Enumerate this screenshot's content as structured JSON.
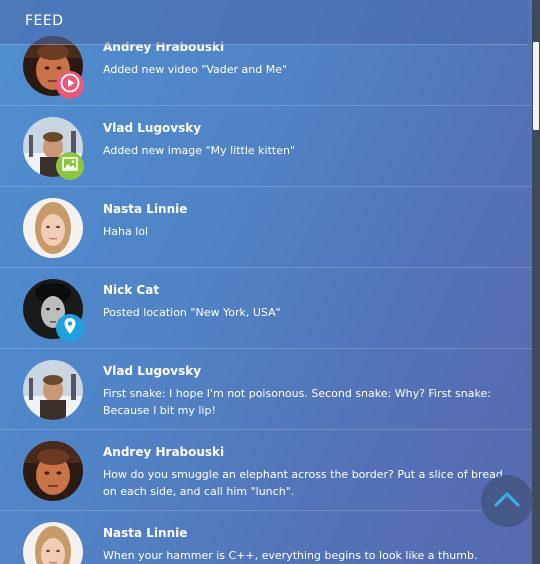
{
  "header": {
    "title": "FEED"
  },
  "feed": [
    {
      "name": "Andrey Hrabouski",
      "text": "Added new video \"Vader and Me\"",
      "avatar": "andrey",
      "badge": "video"
    },
    {
      "name": "Vlad Lugovsky",
      "text": "Added new image \"My little kitten\"",
      "avatar": "vlad",
      "badge": "image"
    },
    {
      "name": "Nasta Linnie",
      "text": "Haha lol",
      "avatar": "nasta",
      "badge": ""
    },
    {
      "name": "Nick Cat",
      "text": "Posted location \"New York, USA\"",
      "avatar": "nick",
      "badge": "location"
    },
    {
      "name": "Vlad Lugovsky",
      "text": "First snake: I hope I'm not poisonous. Second snake: Why? First snake: Because I bit my lip!",
      "avatar": "vlad",
      "badge": ""
    },
    {
      "name": "Andrey Hrabouski",
      "text": "How do you smuggle an elephant across the border? Put a slice of bread on each side, and call him \"lunch\".",
      "avatar": "andrey",
      "badge": ""
    },
    {
      "name": "Nasta Linnie",
      "text": "When your hammer is C++, everything begins to look like a thumb.",
      "avatar": "nasta",
      "badge": ""
    }
  ],
  "badge_colors": {
    "video": "#e85a7a",
    "image": "#8cc63f",
    "location": "#1fa0e0"
  },
  "icons": {
    "video": "play-icon",
    "image": "image-icon",
    "location": "map-pin-icon",
    "fab": "chevron-up-icon"
  }
}
